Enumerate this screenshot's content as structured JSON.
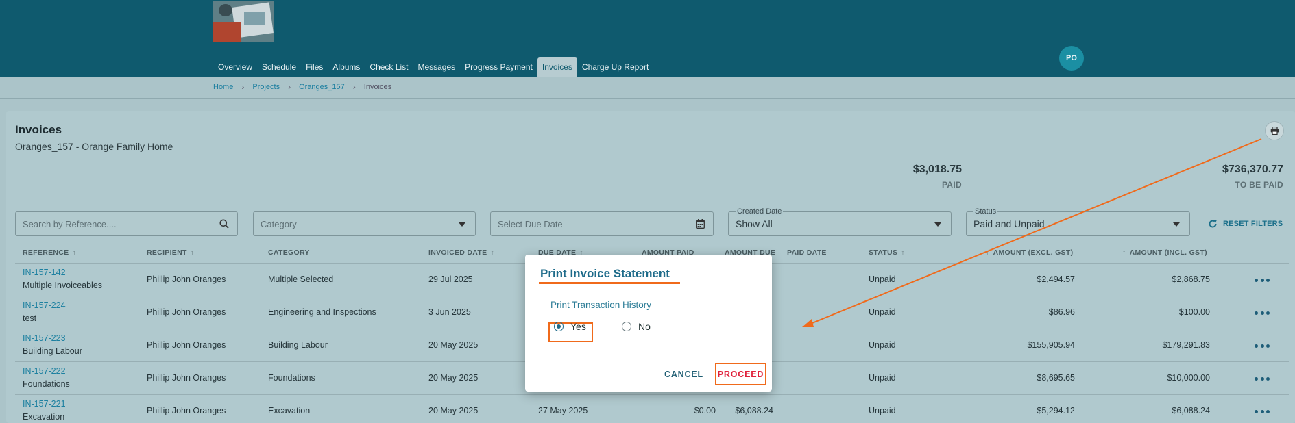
{
  "colors": {
    "header": "#0f5a6e",
    "accent": "#1e6b8a",
    "highlight": "#f06a1b",
    "danger": "#e0223b"
  },
  "nav": {
    "tabs": [
      "Overview",
      "Schedule",
      "Files",
      "Albums",
      "Check List",
      "Messages",
      "Progress Payment",
      "Invoices",
      "Charge Up Report"
    ],
    "active": "Invoices"
  },
  "avatar": {
    "initials": "PO"
  },
  "breadcrumb": {
    "home": "Home",
    "projects": "Projects",
    "project": "Oranges_157",
    "current": "Invoices"
  },
  "page": {
    "title": "Invoices",
    "subtitle": "Oranges_157 - Orange Family Home",
    "print_icon": "printer-icon"
  },
  "summary": {
    "paid": {
      "amount": "$3,018.75",
      "label": "PAID"
    },
    "to_be_paid": {
      "amount": "$736,370.77",
      "label": "TO BE PAID"
    }
  },
  "filters": {
    "search_placeholder": "Search by Reference....",
    "category_placeholder": "Category",
    "due_date_placeholder": "Select Due Date",
    "created_label": "Created Date",
    "created_value": "Show All",
    "status_label": "Status",
    "status_value": "Paid and Unpaid",
    "reset": "RESET FILTERS"
  },
  "table": {
    "headers": {
      "reference": "REFERENCE",
      "recipient": "RECIPIENT",
      "category": "CATEGORY",
      "invoiced": "INVOICED DATE",
      "due": "DUE DATE",
      "amount_paid": "AMOUNT PAID",
      "amount_due": "AMOUNT DUE",
      "paid_date": "PAID DATE",
      "status": "STATUS",
      "excl": "AMOUNT (EXCL. GST)",
      "incl": "AMOUNT (INCL. GST)"
    },
    "rows": [
      {
        "ref": "IN-157-142",
        "desc": "Multiple Invoiceables",
        "recipient": "Phillip John Oranges",
        "category": "Multiple Selected",
        "invoiced": "29 Jul 2025",
        "due": "",
        "paid": "",
        "amount_due": "",
        "status": "Unpaid",
        "excl": "$2,494.57",
        "incl": "$2,868.75"
      },
      {
        "ref": "IN-157-224",
        "desc": "test",
        "recipient": "Phillip John Oranges",
        "category": "Engineering and Inspections",
        "invoiced": "3 Jun 2025",
        "due": "",
        "paid": "",
        "amount_due": "",
        "status": "Unpaid",
        "excl": "$86.96",
        "incl": "$100.00"
      },
      {
        "ref": "IN-157-223",
        "desc": "Building Labour",
        "recipient": "Phillip John Oranges",
        "category": "Building Labour",
        "invoiced": "20 May 2025",
        "due": "",
        "paid": "",
        "amount_due": "",
        "status": "Unpaid",
        "excl": "$155,905.94",
        "incl": "$179,291.83"
      },
      {
        "ref": "IN-157-222",
        "desc": "Foundations",
        "recipient": "Phillip John Oranges",
        "category": "Foundations",
        "invoiced": "20 May 2025",
        "due": "",
        "paid": "",
        "amount_due": "",
        "status": "Unpaid",
        "excl": "$8,695.65",
        "incl": "$10,000.00"
      },
      {
        "ref": "IN-157-221",
        "desc": "Excavation",
        "recipient": "Phillip John Oranges",
        "category": "Excavation",
        "invoiced": "20 May 2025",
        "due": "27 May 2025",
        "paid": "$0.00",
        "amount_due": "$6,088.24",
        "status": "Unpaid",
        "excl": "$5,294.12",
        "incl": "$6,088.24"
      }
    ]
  },
  "dialog": {
    "title": "Print Invoice Statement",
    "question": "Print Transaction History",
    "yes": "Yes",
    "no": "No",
    "selected": "Yes",
    "cancel": "CANCEL",
    "proceed": "PROCEED"
  }
}
